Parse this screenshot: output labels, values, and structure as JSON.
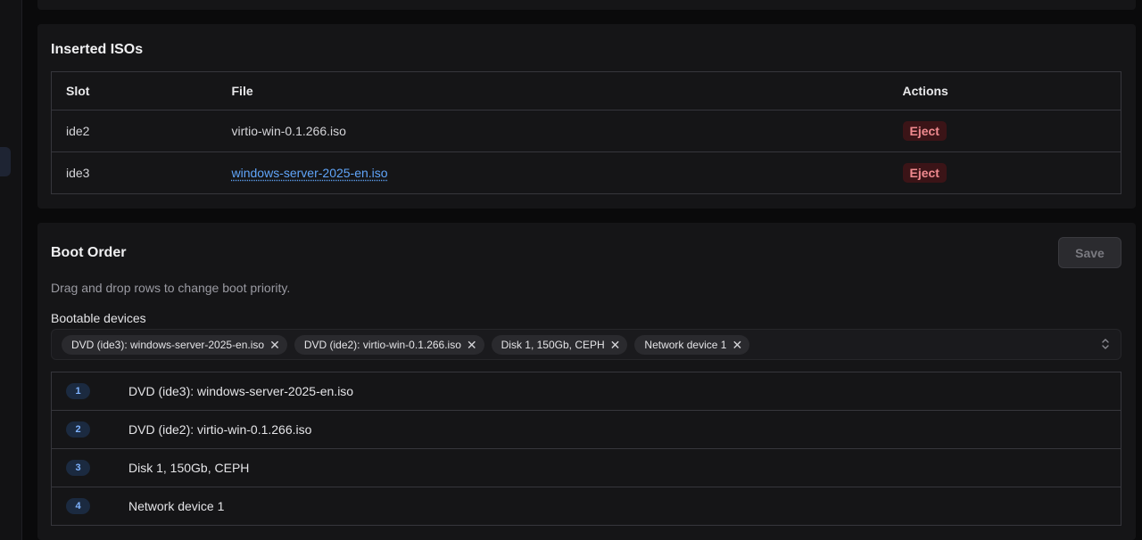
{
  "iso_section": {
    "title": "Inserted ISOs",
    "columns": {
      "slot": "Slot",
      "file": "File",
      "actions": "Actions"
    },
    "rows": [
      {
        "slot": "ide2",
        "file": "virtio-win-0.1.266.iso",
        "action": "Eject",
        "linked": false
      },
      {
        "slot": "ide3",
        "file": "windows-server-2025-en.iso",
        "action": "Eject",
        "linked": true
      }
    ]
  },
  "boot_section": {
    "title": "Boot Order",
    "save_label": "Save",
    "hint": "Drag and drop rows to change boot priority.",
    "field_label": "Bootable devices",
    "selected_chips": [
      "DVD (ide3): windows-server-2025-en.iso",
      "DVD (ide2): virtio-win-0.1.266.iso",
      "Disk 1, 150Gb, CEPH",
      "Network device 1"
    ],
    "chip_remove_glyph": "✕",
    "order": [
      {
        "n": "1",
        "name": "DVD (ide3): windows-server-2025-en.iso"
      },
      {
        "n": "2",
        "name": "DVD (ide2): virtio-win-0.1.266.iso"
      },
      {
        "n": "3",
        "name": "Disk 1, 150Gb, CEPH"
      },
      {
        "n": "4",
        "name": "Network device 1"
      }
    ]
  },
  "colors": {
    "link": "#60a5fa",
    "danger_bg": "#3b1417",
    "danger_text": "#f08a8f",
    "badge_bg": "#1b2a40",
    "badge_text": "#7fb3ff"
  }
}
